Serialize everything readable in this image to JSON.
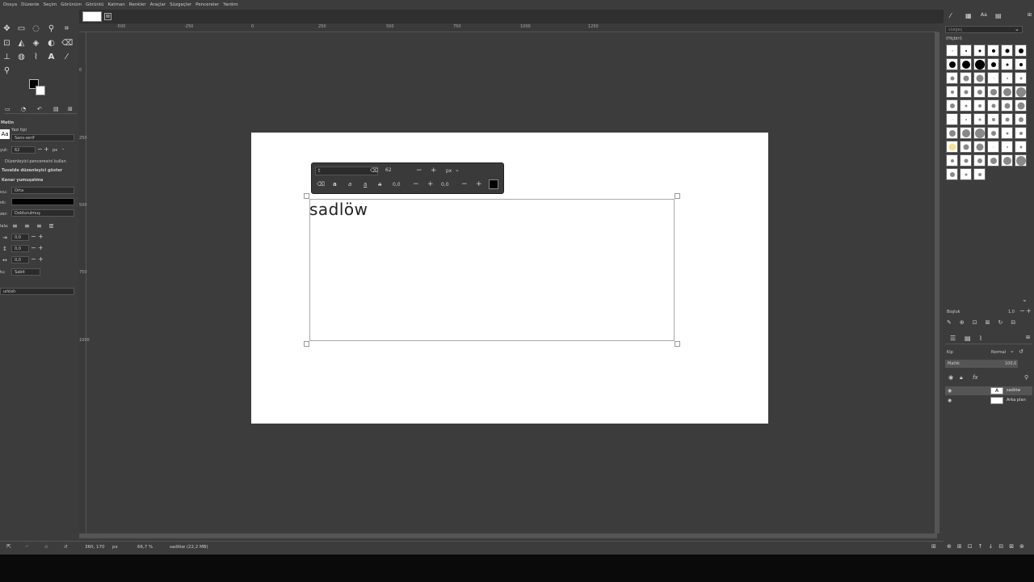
{
  "menu": [
    "Dosya",
    "Düzenle",
    "Seçim",
    "Görünüm",
    "Görüntü",
    "Katman",
    "Renkler",
    "Araçlar",
    "Süzgeçler",
    "Pencereler",
    "Yardım"
  ],
  "image_tab": {
    "close_label": "⊠"
  },
  "rulers": {
    "h_ticks": [
      "-500",
      "-250",
      "0",
      "250",
      "500",
      "750",
      "1000",
      "1250"
    ],
    "v_ticks": [
      "0",
      "250",
      "500",
      "750",
      "1000"
    ]
  },
  "tool_options": {
    "title": "Metin",
    "font_label": "Yazı tipi",
    "font_preview": "Aa",
    "font_value": "Sans-serif",
    "size_label": "yut:",
    "size_value": "62",
    "size_unit": "px",
    "use_editor": "Düzenleyici penceresini kullan",
    "show_editor": "Tuvalde düzenleyici göster",
    "antialias": "Kenar yumuşatma",
    "hinting_label": "ıcu:",
    "hinting_value": "Orta",
    "color_label": "nk:",
    "justify_label": "zer:",
    "justify_value": "Doldurulmuş",
    "align_label": "lala:",
    "indent_value": "0,0",
    "line_spacing_value": "0,0",
    "letter_spacing_value": "0,0",
    "box_label": "tu:",
    "box_value": "Sabit",
    "language": "urkish"
  },
  "canvas": {
    "text": "sadlöw"
  },
  "text_toolbar": {
    "font_value": "t",
    "size_value": "62",
    "unit": "px",
    "baseline_value": "0,0",
    "kerning_value": "0,0",
    "style_buttons": [
      "a",
      "a",
      "a",
      "a",
      "a"
    ]
  },
  "status": {
    "coords": "360, 170",
    "unit": "px",
    "zoom": "66,7 %",
    "info": "sadlöw (22,2 MB)"
  },
  "right_panel": {
    "filter_placeholder": "süzgeç",
    "tag": "(Hiçbiri)",
    "spacing_label": "Boşluk",
    "spacing_value": "1,0",
    "mode_label": "Kip",
    "mode_value": "Normal",
    "opacity_label": "Matlık",
    "opacity_value": "100,0",
    "layers": [
      {
        "name": "sadlöw"
      },
      {
        "name": "Arka plan"
      }
    ]
  }
}
